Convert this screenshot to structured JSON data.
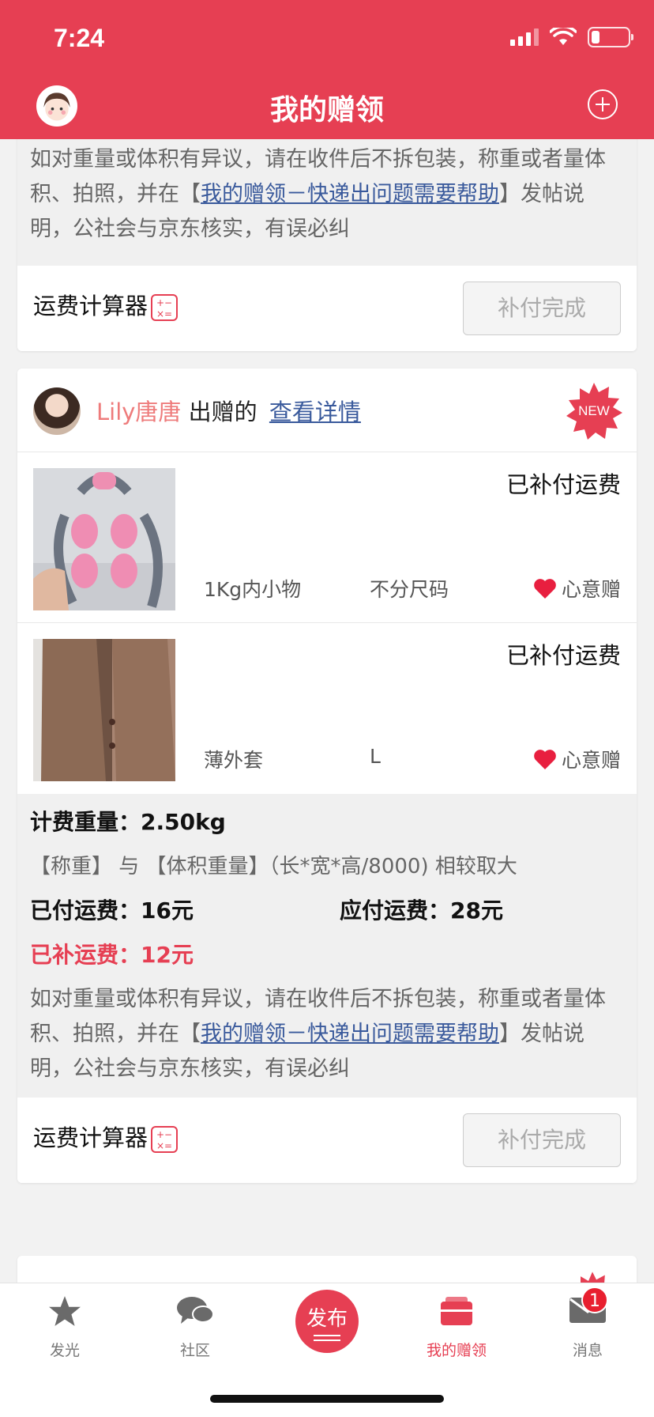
{
  "status_bar": {
    "time": "7:24"
  },
  "header": {
    "title": "我的赠领"
  },
  "note": {
    "text_before": "如对重量或体积有异议，请在收件后不拆包装，称重或者量体积、拍照，并在【",
    "link": "我的赠领－快递出问题需要帮助",
    "text_after": "】发帖说明，公社会与京东核实，有误必纠"
  },
  "calc": {
    "label": "运费计算器",
    "button": "补付完成"
  },
  "card": {
    "giver_name": "Lily唐唐",
    "giver_action": "出赠的",
    "detail_link": "查看详情",
    "badge": "NEW",
    "items": [
      {
        "status": "已补付运费",
        "name": "1Kg内小物",
        "size": "不分尺码",
        "type": "心意赠"
      },
      {
        "status": "已补付运费",
        "name": "薄外套",
        "size": "L",
        "type": "心意赠"
      }
    ],
    "fees": {
      "weight_label": "计费重量：",
      "weight_value": "2.50kg",
      "rule": "【称重】 与 【体积重量】（长*宽*高/8000) 相较取大",
      "paid_label": "已付运费：",
      "paid_value": "16元",
      "due_label": "应付运费：",
      "due_value": "28元",
      "supp_label": "已补运费：",
      "supp_value": "12元"
    }
  },
  "tabbar": {
    "items": [
      {
        "label": "发光",
        "icon": "star-icon"
      },
      {
        "label": "社区",
        "icon": "chat-bubbles-icon"
      },
      {
        "label": "发布",
        "icon": "publish-button"
      },
      {
        "label": "我的赠领",
        "icon": "gift-box-icon"
      },
      {
        "label": "消息",
        "icon": "mail-icon"
      }
    ],
    "message_badge": "1"
  },
  "colors": {
    "brand": "#e63f53",
    "link": "#3a5a9c"
  }
}
